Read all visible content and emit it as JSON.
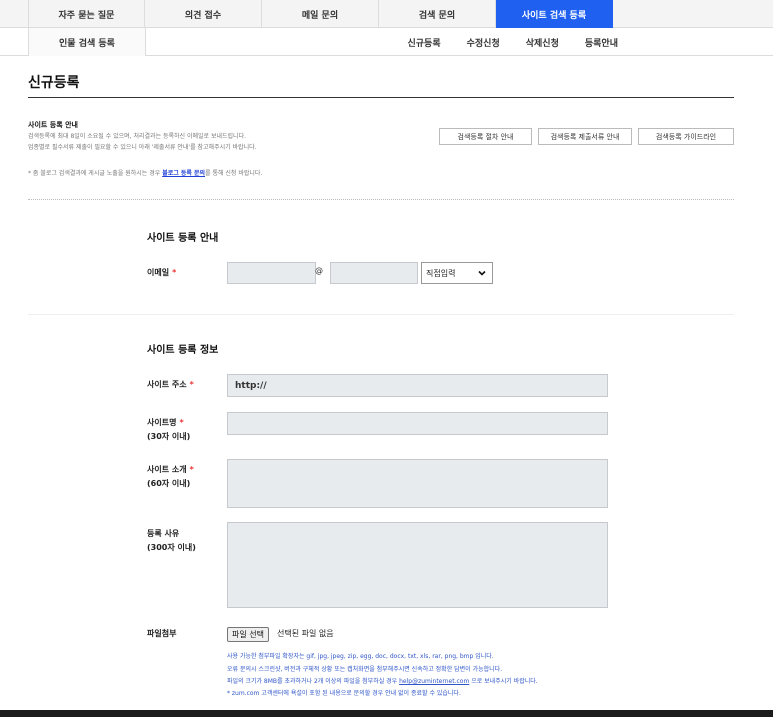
{
  "top_tabs": [
    {
      "label": "자주 묻는 질문"
    },
    {
      "label": "의견 접수"
    },
    {
      "label": "메일 문의"
    },
    {
      "label": "검색 문의"
    },
    {
      "label": "사이트 검색 등록",
      "active": true
    }
  ],
  "sub_nav": {
    "left": "인물 검색 등록",
    "links": [
      "신규등록",
      "수정신청",
      "삭제신청",
      "등록안내"
    ]
  },
  "page_title": "신규등록",
  "guide": {
    "heading": "사이트 등록 안내",
    "lines": [
      "검색등록에 최대 8일이 소요될 수 있으며, 처리결과는 등록하신 이메일로 보내드립니다.",
      "업종별로 필수서류 제출이 필요할 수 있으니 아래 '제출서류 안내'를 참고해주시기 바랍니다."
    ],
    "buttons": [
      "검색등록 절차 안내",
      "검색등록 제출서류 안내",
      "검색등록 가이드라인"
    ],
    "blog_note_prefix": "* 줌 블로그 검색결과에 게시글 노출을 원하시는 경우 ",
    "blog_note_link": "블로그 등록 문의",
    "blog_note_suffix": "를 통해 신청 바랍니다."
  },
  "section1": {
    "title": "사이트 등록 안내",
    "email_label": "이메일",
    "required_mark": "*",
    "at": "@",
    "domain_select": "직접입력"
  },
  "section2": {
    "title": "사이트 등록 정보",
    "url_label": "사이트 주소",
    "url_value": "http://",
    "name_label": "사이트명",
    "name_hint": "(30자 이내)",
    "intro_label": "사이트 소개",
    "intro_hint": "(60자 이내)",
    "reason_label": "등록 사유",
    "reason_hint": "(300자 이내)",
    "file_label": "파일첨부",
    "file_button": "파일 선택",
    "file_status": "선택된 파일 없음",
    "file_notes": [
      "사용 가능한 첨부파일 확장자는 gif, jpg, jpeg, zip, egg, doc, docx, txt, xls, rar, png, bmp 입니다.",
      "오류 문의시 스크린샷, 버전과 구체적 상황 또는 캡처화면을 첨부해주시면 신속하고 정확한 답변이 가능합니다.",
      "파일의 크기가 8MB를 초과하거나 2개 이상의 파일을 첨부하실 경우 ",
      "* zum.com 고객센터에 욕설이 포함 된 내용으로 문의할 경우 안내 없이 종료할 수 있습니다."
    ],
    "file_note_email": "help@zuminternet.com",
    "file_note_email_suffix": " 으로 보내주시기 바랍니다."
  },
  "colors": {
    "accent": "#1f60f0",
    "required": "#e33333",
    "link": "#1f3fd6"
  }
}
